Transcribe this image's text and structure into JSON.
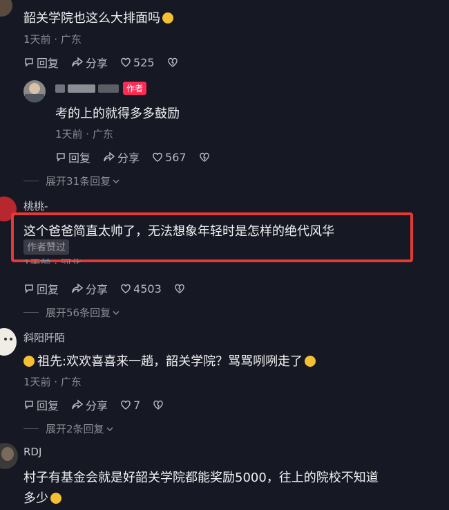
{
  "comments": [
    {
      "text": "韶关学院也这么大排面吗",
      "meta": "1天前 · 广东",
      "reply_label": "回复",
      "share_label": "分享",
      "likes": "525"
    },
    {
      "author_badge": "作者",
      "text": "考的上的就得多多鼓励",
      "meta": "1天前 · 广东",
      "reply_label": "回复",
      "share_label": "分享",
      "likes": "567",
      "expand": "展开31条回复"
    },
    {
      "name": "桃桃-",
      "text": "这个爸爸简直太帅了，无法想象年轻时是怎样的绝代风华",
      "liked_badge": "作者赞过",
      "meta": "1天前 · 河北",
      "reply_label": "回复",
      "share_label": "分享",
      "likes": "4503",
      "expand": "展开56条回复"
    },
    {
      "name": "斜阳阡陌",
      "text": "祖先:欢欢喜喜来一趟，韶关学院？骂骂咧咧走了",
      "meta": "1天前 · 广东",
      "reply_label": "回复",
      "share_label": "分享",
      "likes": "7",
      "expand": "展开2条回复"
    },
    {
      "name": "RDJ",
      "text_line1": "村子有基金会就是好韶关学院都能奖励5000，往上的院校不知道",
      "text_line2": "多少"
    }
  ],
  "colors": {
    "background": "#161823",
    "highlight_box": "#e53935",
    "author_badge": "#fe2c55"
  }
}
